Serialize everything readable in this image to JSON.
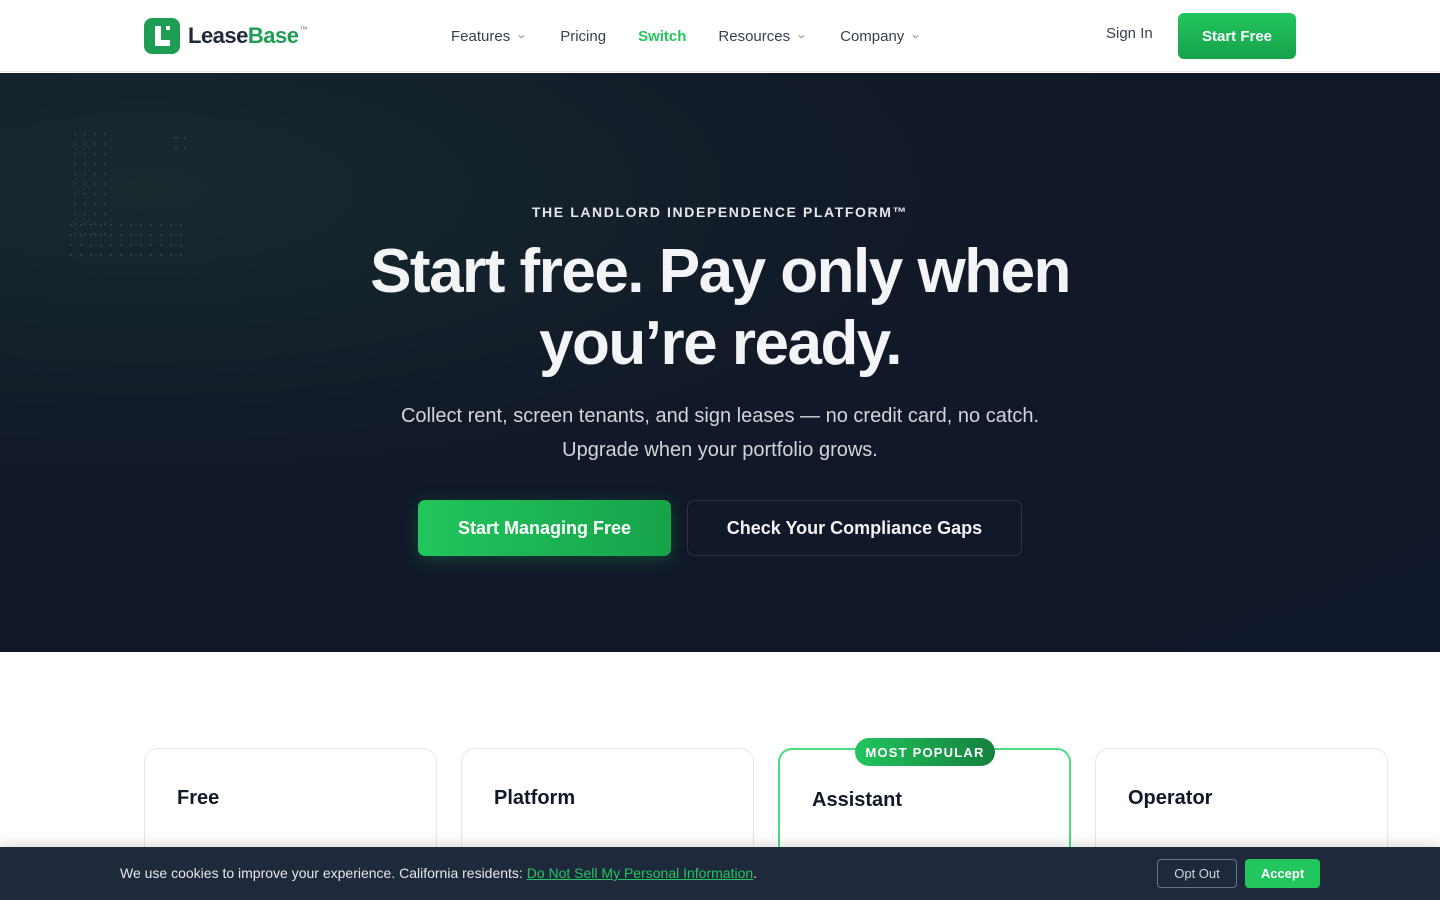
{
  "brand": {
    "name_part1": "Lease",
    "name_part2": "Base",
    "trademark": "™",
    "primary_color": "#22c55e",
    "dark_green": "#1f9d55"
  },
  "nav": {
    "items": [
      {
        "label": "Features",
        "has_dropdown": true
      },
      {
        "label": "Pricing",
        "has_dropdown": false
      },
      {
        "label": "Switch",
        "has_dropdown": false,
        "active": true
      },
      {
        "label": "Resources",
        "has_dropdown": true
      },
      {
        "label": "Company",
        "has_dropdown": true
      }
    ],
    "sign_in": "Sign In",
    "cta": "Start Free"
  },
  "hero": {
    "eyebrow": "THE LANDLORD INDEPENDENCE PLATFORM™",
    "headline": "Start free. Pay only when you’re ready.",
    "subhead": "Collect rent, screen tenants, and sign leases — no credit card, no catch. Upgrade when your portfolio grows.",
    "primary_button": "Start Managing Free",
    "secondary_button": "Check Your Compliance Gaps",
    "background_color": "#111827"
  },
  "pricing": {
    "popular_badge": "MOST POPULAR",
    "plans": [
      {
        "name": "Free"
      },
      {
        "name": "Platform"
      },
      {
        "name": "Assistant",
        "popular": true
      },
      {
        "name": "Operator"
      }
    ]
  },
  "cookie_banner": {
    "text": "We use cookies to improve your experience. California residents: ",
    "link": "Do Not Sell My Personal Information",
    "period": ".",
    "opt_out": "Opt Out",
    "accept": "Accept",
    "background_color": "#1e293b"
  }
}
